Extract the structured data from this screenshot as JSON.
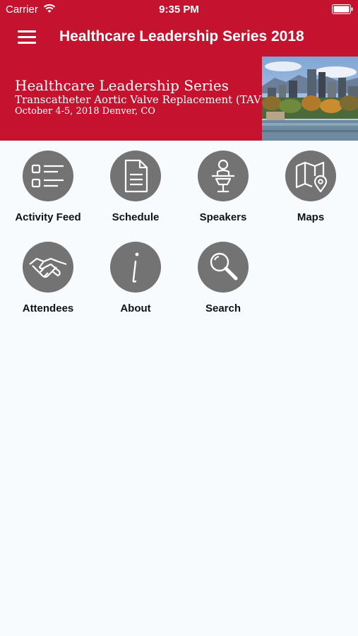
{
  "status_bar": {
    "carrier": "Carrier",
    "time": "9:35 PM"
  },
  "nav": {
    "title": "Healthcare Leadership Series 2018"
  },
  "banner": {
    "title": "Healthcare Leadership Series",
    "subtitle": "Transcatheter Aortic Valve Replacement (TAVR)",
    "date": "October 4-5, 2018 Denver, CO"
  },
  "tiles": [
    {
      "label": "Activity Feed",
      "icon": "list-icon"
    },
    {
      "label": "Schedule",
      "icon": "document-icon"
    },
    {
      "label": "Speakers",
      "icon": "speaker-podium-icon"
    },
    {
      "label": "Maps",
      "icon": "map-icon"
    },
    {
      "label": "Attendees",
      "icon": "handshake-icon"
    },
    {
      "label": "About",
      "icon": "info-icon"
    },
    {
      "label": "Search",
      "icon": "magnifier-icon"
    }
  ],
  "colors": {
    "brand": "#c4122f",
    "icon_circle": "#737373",
    "background": "#f8fbfd"
  }
}
